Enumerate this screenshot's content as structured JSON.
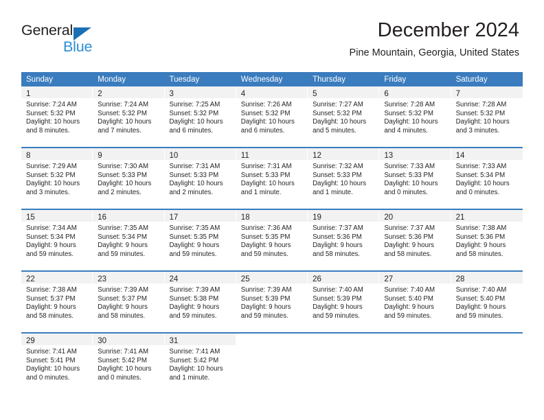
{
  "brand": {
    "name_part1": "General",
    "name_part2": "Blue",
    "triangle_icon": "triangle-icon",
    "color_dark": "#231f20",
    "color_blue": "#2a8fd4",
    "color_triangle": "#1a6fb5"
  },
  "header": {
    "title": "December 2024",
    "subtitle": "Pine Mountain, Georgia, United States"
  },
  "theme": {
    "header_row_bg": "#3a7cbe",
    "header_row_text": "#ffffff",
    "daynum_band_bg": "#f2f2f2",
    "cell_bg": "#ffffff",
    "text": "#231f20"
  },
  "calendar": {
    "weekdays": [
      "Sunday",
      "Monday",
      "Tuesday",
      "Wednesday",
      "Thursday",
      "Friday",
      "Saturday"
    ],
    "weeks": [
      [
        {
          "day": "1",
          "sunrise": "Sunrise: 7:24 AM",
          "sunset": "Sunset: 5:32 PM",
          "daylight_line1": "Daylight: 10 hours",
          "daylight_line2": "and 8 minutes."
        },
        {
          "day": "2",
          "sunrise": "Sunrise: 7:24 AM",
          "sunset": "Sunset: 5:32 PM",
          "daylight_line1": "Daylight: 10 hours",
          "daylight_line2": "and 7 minutes."
        },
        {
          "day": "3",
          "sunrise": "Sunrise: 7:25 AM",
          "sunset": "Sunset: 5:32 PM",
          "daylight_line1": "Daylight: 10 hours",
          "daylight_line2": "and 6 minutes."
        },
        {
          "day": "4",
          "sunrise": "Sunrise: 7:26 AM",
          "sunset": "Sunset: 5:32 PM",
          "daylight_line1": "Daylight: 10 hours",
          "daylight_line2": "and 6 minutes."
        },
        {
          "day": "5",
          "sunrise": "Sunrise: 7:27 AM",
          "sunset": "Sunset: 5:32 PM",
          "daylight_line1": "Daylight: 10 hours",
          "daylight_line2": "and 5 minutes."
        },
        {
          "day": "6",
          "sunrise": "Sunrise: 7:28 AM",
          "sunset": "Sunset: 5:32 PM",
          "daylight_line1": "Daylight: 10 hours",
          "daylight_line2": "and 4 minutes."
        },
        {
          "day": "7",
          "sunrise": "Sunrise: 7:28 AM",
          "sunset": "Sunset: 5:32 PM",
          "daylight_line1": "Daylight: 10 hours",
          "daylight_line2": "and 3 minutes."
        }
      ],
      [
        {
          "day": "8",
          "sunrise": "Sunrise: 7:29 AM",
          "sunset": "Sunset: 5:32 PM",
          "daylight_line1": "Daylight: 10 hours",
          "daylight_line2": "and 3 minutes."
        },
        {
          "day": "9",
          "sunrise": "Sunrise: 7:30 AM",
          "sunset": "Sunset: 5:33 PM",
          "daylight_line1": "Daylight: 10 hours",
          "daylight_line2": "and 2 minutes."
        },
        {
          "day": "10",
          "sunrise": "Sunrise: 7:31 AM",
          "sunset": "Sunset: 5:33 PM",
          "daylight_line1": "Daylight: 10 hours",
          "daylight_line2": "and 2 minutes."
        },
        {
          "day": "11",
          "sunrise": "Sunrise: 7:31 AM",
          "sunset": "Sunset: 5:33 PM",
          "daylight_line1": "Daylight: 10 hours",
          "daylight_line2": "and 1 minute."
        },
        {
          "day": "12",
          "sunrise": "Sunrise: 7:32 AM",
          "sunset": "Sunset: 5:33 PM",
          "daylight_line1": "Daylight: 10 hours",
          "daylight_line2": "and 1 minute."
        },
        {
          "day": "13",
          "sunrise": "Sunrise: 7:33 AM",
          "sunset": "Sunset: 5:33 PM",
          "daylight_line1": "Daylight: 10 hours",
          "daylight_line2": "and 0 minutes."
        },
        {
          "day": "14",
          "sunrise": "Sunrise: 7:33 AM",
          "sunset": "Sunset: 5:34 PM",
          "daylight_line1": "Daylight: 10 hours",
          "daylight_line2": "and 0 minutes."
        }
      ],
      [
        {
          "day": "15",
          "sunrise": "Sunrise: 7:34 AM",
          "sunset": "Sunset: 5:34 PM",
          "daylight_line1": "Daylight: 9 hours",
          "daylight_line2": "and 59 minutes."
        },
        {
          "day": "16",
          "sunrise": "Sunrise: 7:35 AM",
          "sunset": "Sunset: 5:34 PM",
          "daylight_line1": "Daylight: 9 hours",
          "daylight_line2": "and 59 minutes."
        },
        {
          "day": "17",
          "sunrise": "Sunrise: 7:35 AM",
          "sunset": "Sunset: 5:35 PM",
          "daylight_line1": "Daylight: 9 hours",
          "daylight_line2": "and 59 minutes."
        },
        {
          "day": "18",
          "sunrise": "Sunrise: 7:36 AM",
          "sunset": "Sunset: 5:35 PM",
          "daylight_line1": "Daylight: 9 hours",
          "daylight_line2": "and 59 minutes."
        },
        {
          "day": "19",
          "sunrise": "Sunrise: 7:37 AM",
          "sunset": "Sunset: 5:36 PM",
          "daylight_line1": "Daylight: 9 hours",
          "daylight_line2": "and 58 minutes."
        },
        {
          "day": "20",
          "sunrise": "Sunrise: 7:37 AM",
          "sunset": "Sunset: 5:36 PM",
          "daylight_line1": "Daylight: 9 hours",
          "daylight_line2": "and 58 minutes."
        },
        {
          "day": "21",
          "sunrise": "Sunrise: 7:38 AM",
          "sunset": "Sunset: 5:36 PM",
          "daylight_line1": "Daylight: 9 hours",
          "daylight_line2": "and 58 minutes."
        }
      ],
      [
        {
          "day": "22",
          "sunrise": "Sunrise: 7:38 AM",
          "sunset": "Sunset: 5:37 PM",
          "daylight_line1": "Daylight: 9 hours",
          "daylight_line2": "and 58 minutes."
        },
        {
          "day": "23",
          "sunrise": "Sunrise: 7:39 AM",
          "sunset": "Sunset: 5:37 PM",
          "daylight_line1": "Daylight: 9 hours",
          "daylight_line2": "and 58 minutes."
        },
        {
          "day": "24",
          "sunrise": "Sunrise: 7:39 AM",
          "sunset": "Sunset: 5:38 PM",
          "daylight_line1": "Daylight: 9 hours",
          "daylight_line2": "and 59 minutes."
        },
        {
          "day": "25",
          "sunrise": "Sunrise: 7:39 AM",
          "sunset": "Sunset: 5:39 PM",
          "daylight_line1": "Daylight: 9 hours",
          "daylight_line2": "and 59 minutes."
        },
        {
          "day": "26",
          "sunrise": "Sunrise: 7:40 AM",
          "sunset": "Sunset: 5:39 PM",
          "daylight_line1": "Daylight: 9 hours",
          "daylight_line2": "and 59 minutes."
        },
        {
          "day": "27",
          "sunrise": "Sunrise: 7:40 AM",
          "sunset": "Sunset: 5:40 PM",
          "daylight_line1": "Daylight: 9 hours",
          "daylight_line2": "and 59 minutes."
        },
        {
          "day": "28",
          "sunrise": "Sunrise: 7:40 AM",
          "sunset": "Sunset: 5:40 PM",
          "daylight_line1": "Daylight: 9 hours",
          "daylight_line2": "and 59 minutes."
        }
      ],
      [
        {
          "day": "29",
          "sunrise": "Sunrise: 7:41 AM",
          "sunset": "Sunset: 5:41 PM",
          "daylight_line1": "Daylight: 10 hours",
          "daylight_line2": "and 0 minutes."
        },
        {
          "day": "30",
          "sunrise": "Sunrise: 7:41 AM",
          "sunset": "Sunset: 5:42 PM",
          "daylight_line1": "Daylight: 10 hours",
          "daylight_line2": "and 0 minutes."
        },
        {
          "day": "31",
          "sunrise": "Sunrise: 7:41 AM",
          "sunset": "Sunset: 5:42 PM",
          "daylight_line1": "Daylight: 10 hours",
          "daylight_line2": "and 1 minute."
        },
        {
          "day": "",
          "sunrise": "",
          "sunset": "",
          "daylight_line1": "",
          "daylight_line2": ""
        },
        {
          "day": "",
          "sunrise": "",
          "sunset": "",
          "daylight_line1": "",
          "daylight_line2": ""
        },
        {
          "day": "",
          "sunrise": "",
          "sunset": "",
          "daylight_line1": "",
          "daylight_line2": ""
        },
        {
          "day": "",
          "sunrise": "",
          "sunset": "",
          "daylight_line1": "",
          "daylight_line2": ""
        }
      ]
    ]
  }
}
